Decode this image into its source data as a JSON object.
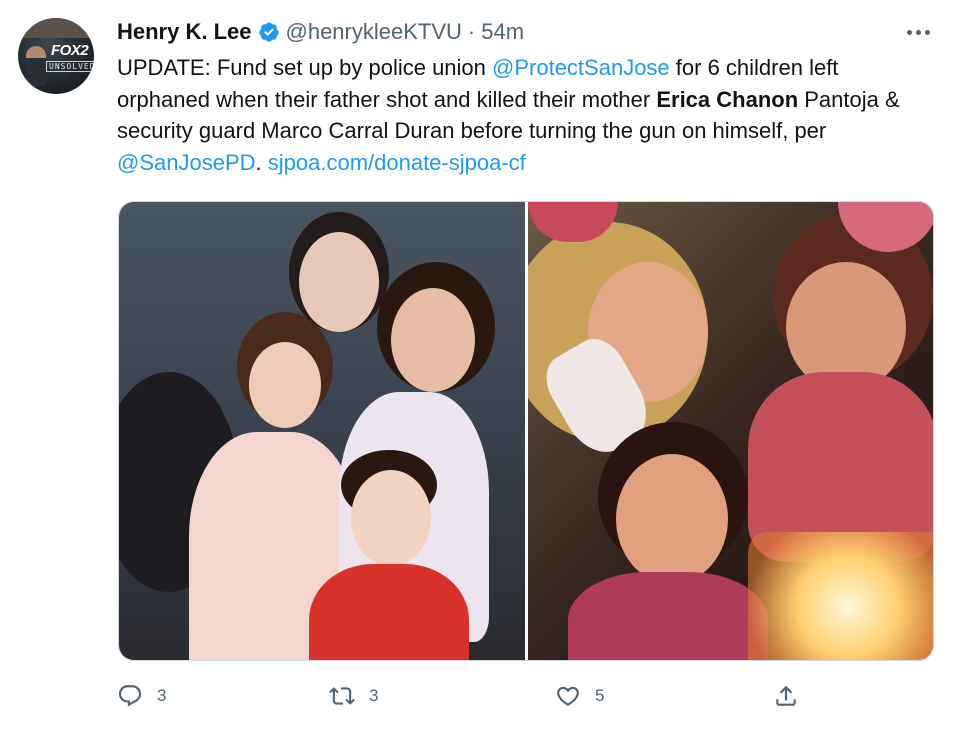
{
  "tweet": {
    "author_name": "Henry K. Lee",
    "handle": "@henrykleeKTVU",
    "separator": "·",
    "time": "54m",
    "text_segments": [
      {
        "text": "UPDATE: Fund set up by police union ",
        "style": "plain"
      },
      {
        "text": "@ProtectSanJose",
        "style": "link"
      },
      {
        "text": " for 6 children left orphaned when their father shot and killed their mother ",
        "style": "plain"
      },
      {
        "text": "Erica Chanon",
        "style": "bold"
      },
      {
        "text": " Pantoja & security guard Marco Carral Duran before turning the gun on himself, per ",
        "style": "plain"
      },
      {
        "text": "@SanJosePD",
        "style": "link"
      },
      {
        "text": ". ",
        "style": "plain"
      },
      {
        "text": "sjpoa.com/donate-sjpoa-cf",
        "style": "link"
      }
    ]
  },
  "avatar": {
    "logo_text": "FOX2",
    "badge_text": "UNSOLVED"
  },
  "actions": {
    "reply_count": "3",
    "retweet_count": "3",
    "like_count": "5"
  },
  "icons": [
    "verified-badge-icon",
    "more-options-icon",
    "reply-icon",
    "retweet-icon",
    "like-icon",
    "share-icon"
  ],
  "colors": {
    "link": "#1d9bf0",
    "secondary_text": "#536471",
    "primary_text": "#0f1419",
    "verified": "#1d9bf0"
  }
}
